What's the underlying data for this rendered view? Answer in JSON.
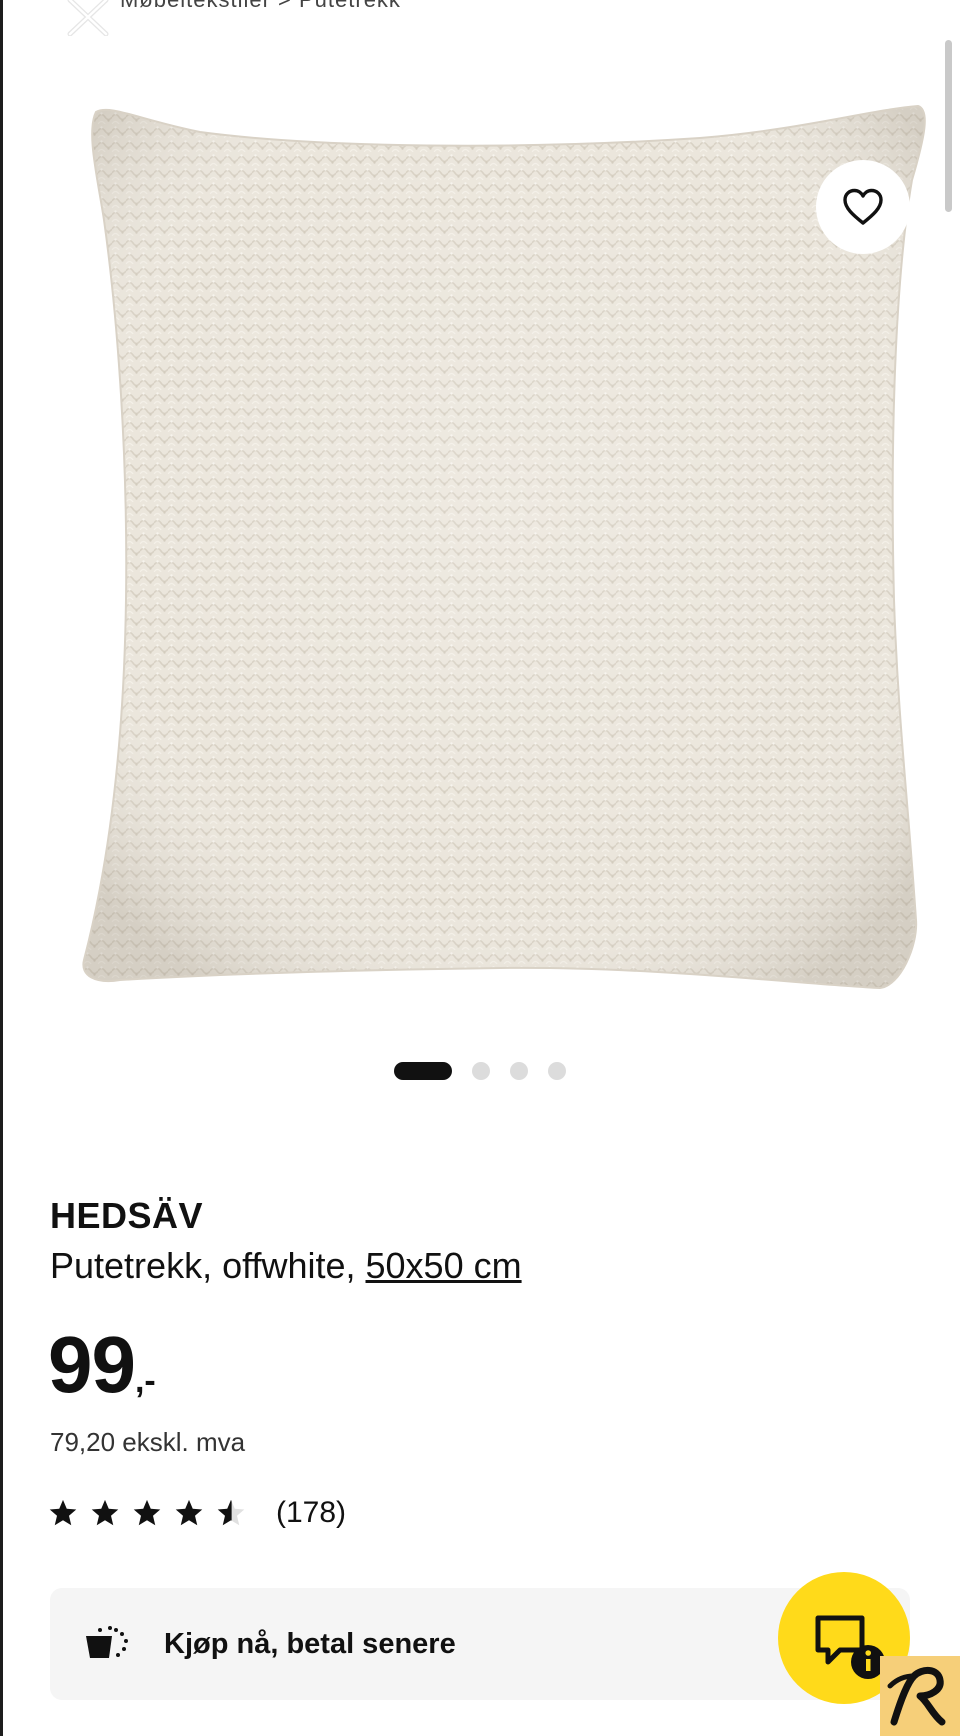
{
  "header": {
    "breadcrumb_text": "Møbeltekstiler  >  Putetrekk",
    "close_icon": "close-icon"
  },
  "gallery": {
    "favorite_icon": "heart-icon",
    "image_count": 4,
    "active_index": 0
  },
  "product": {
    "name": "HEDSÄV",
    "description_prefix": "Putetrekk, offwhite, ",
    "size_link": "50x50 cm",
    "price_integer": "99",
    "price_suffix": ",-",
    "price_ex_vat": "79,20 ekskl. mva",
    "rating": 4.5,
    "rating_max": 5,
    "review_count": "(178)"
  },
  "pay_later": {
    "icon": "cart-icon",
    "label": "Kjøp nå, betal senere"
  },
  "chat": {
    "icon": "chat-info-icon"
  },
  "colors": {
    "accent_yellow": "#ffda1a",
    "text": "#111111",
    "panel_bg": "#f5f5f5",
    "dot_inactive": "#dcdcdc"
  }
}
